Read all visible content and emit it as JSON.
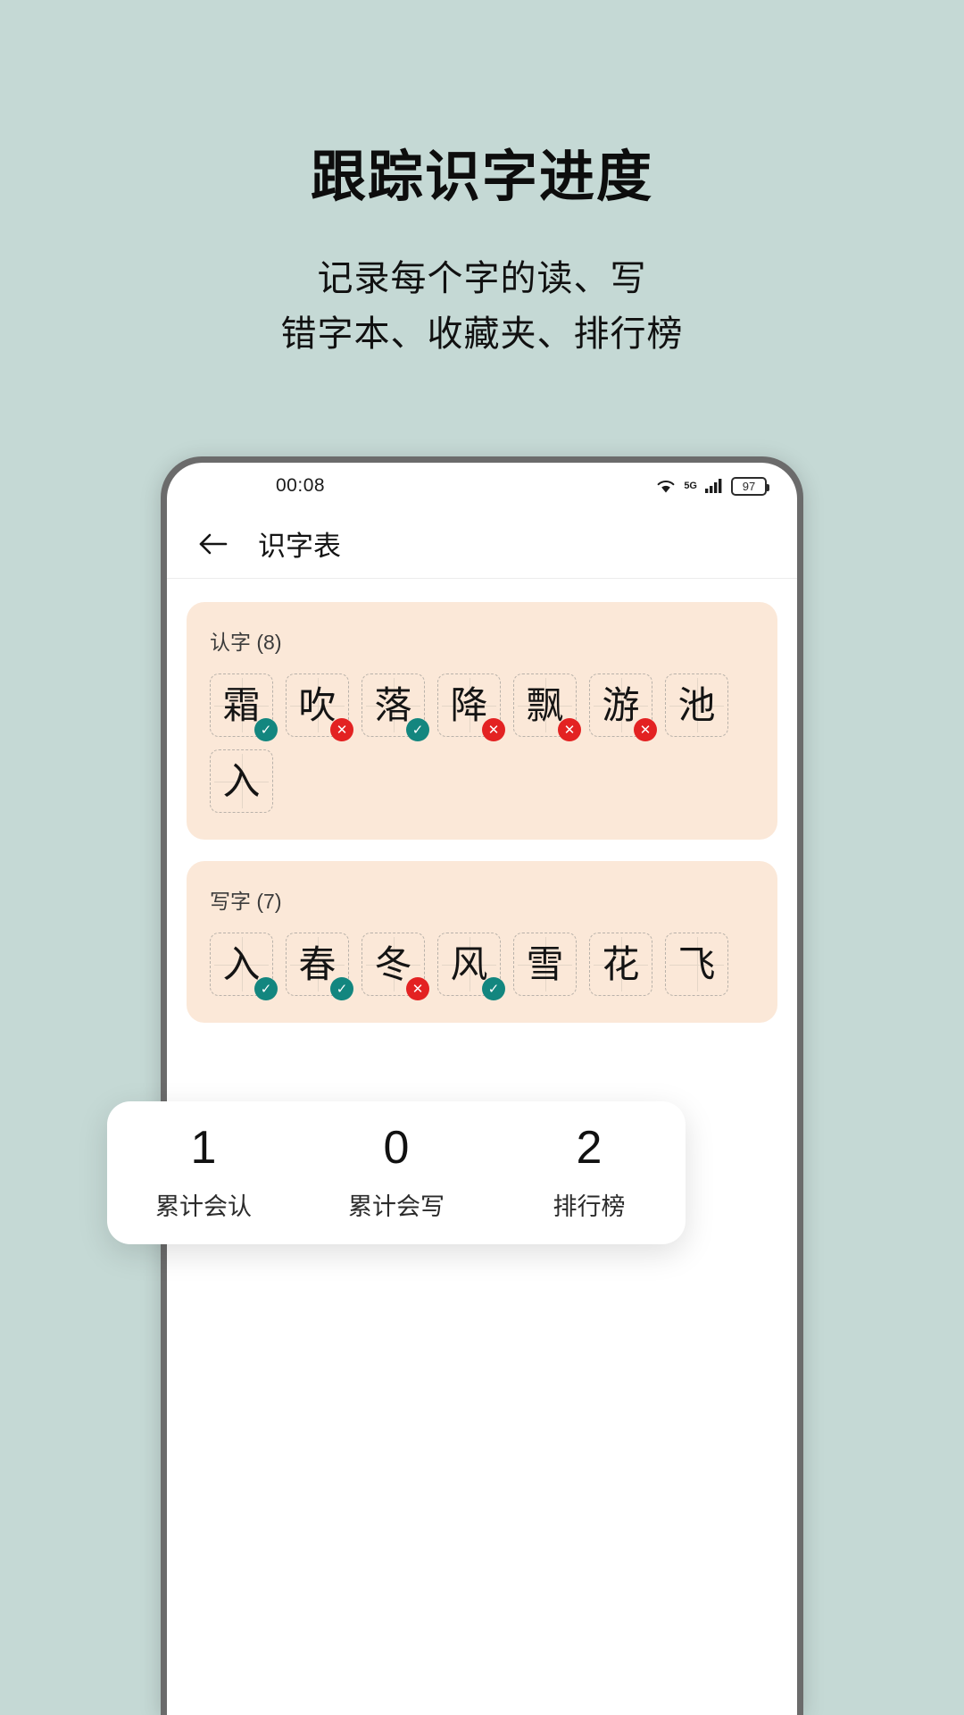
{
  "promo": {
    "title": "跟踪识字进度",
    "subtitle_line1": "记录每个字的读、写",
    "subtitle_line2": "错字本、收藏夹、排行榜"
  },
  "status_bar": {
    "time": "00:08",
    "wifi_icon": "wifi-icon",
    "network_label": "5G",
    "signal_icon": "cellular-signal-icon",
    "battery_level": "97"
  },
  "app_bar": {
    "back_icon": "back-arrow-icon",
    "title": "识字表"
  },
  "sections": [
    {
      "title": "认字 (8)",
      "cells": [
        {
          "char": "霜",
          "status": "ok"
        },
        {
          "char": "吹",
          "status": "bad"
        },
        {
          "char": "落",
          "status": "ok"
        },
        {
          "char": "降",
          "status": "bad"
        },
        {
          "char": "飘",
          "status": "bad"
        },
        {
          "char": "游",
          "status": "bad"
        },
        {
          "char": "池",
          "status": "none"
        },
        {
          "char": "入",
          "status": "none"
        }
      ]
    },
    {
      "title": "写字 (7)",
      "cells": [
        {
          "char": "入",
          "status": "ok"
        },
        {
          "char": "春",
          "status": "ok"
        },
        {
          "char": "冬",
          "status": "bad"
        },
        {
          "char": "风",
          "status": "ok"
        },
        {
          "char": "雪",
          "status": "none"
        },
        {
          "char": "花",
          "status": "none"
        },
        {
          "char": "飞",
          "status": "none"
        }
      ]
    }
  ],
  "stats": [
    {
      "value": "1",
      "label": "累计会认"
    },
    {
      "value": "0",
      "label": "累计会写"
    },
    {
      "value": "2",
      "label": "排行榜"
    }
  ],
  "colors": {
    "background": "#c5d9d5",
    "card": "#fbe8d8",
    "ok_badge": "#13867f",
    "bad_badge": "#e32222"
  },
  "badge_glyphs": {
    "ok": "✓",
    "bad": "✕"
  }
}
